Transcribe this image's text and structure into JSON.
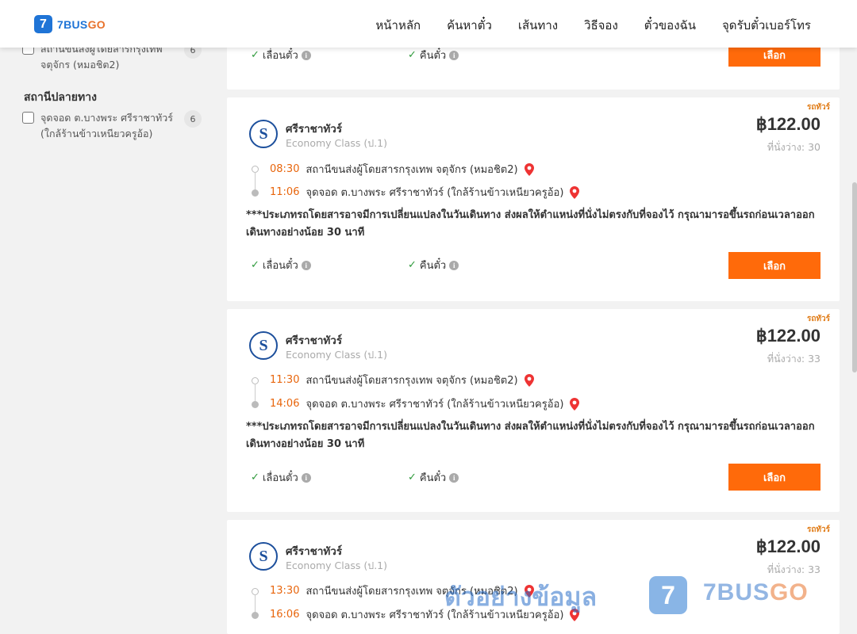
{
  "header": {
    "logo_number": "7",
    "logo_text_main": "BUS",
    "logo_text_go": "GO",
    "nav": [
      "หน้าหลัก",
      "ค้นหาตั๋ว",
      "เส้นทาง",
      "วิธีจอง",
      "ตั๋วของฉัน",
      "จุดรับตั๋วเบอร์โทร"
    ]
  },
  "sidebar": {
    "origin_item": {
      "label": "สถานีขนส่งผู้โดยสารกรุงเทพ จตุจักร (หมอชิต2)",
      "count": "6"
    },
    "destination_heading": "สถานีปลายทาง",
    "destination_item": {
      "label": "จุดจอด ต.บางพระ ศรีราชาทัวร์ (ใกล้ร้านข้าวเหนียวครูอ้อ)",
      "count": "6"
    }
  },
  "top_partial": {
    "feature_reschedule": "เลื่อนตั๋ว",
    "feature_refund": "คืนตั๋ว",
    "select_label": "เลือก"
  },
  "trips": [
    {
      "bus_type": "รถทัวร์",
      "operator": "ศรีราชาทัวร์",
      "class": "Economy Class (ป.1)",
      "price": "฿122.00",
      "seats": "ที่นั่งว่าง: 30",
      "depart_time": "08:30",
      "depart_station": "สถานีขนส่งผู้โดยสารกรุงเทพ จตุจักร (หมอชิต2)",
      "arrive_time": "11:06",
      "arrive_station": "จุดจอด ต.บางพระ ศรีราชาทัวร์ (ใกล้ร้านข้าวเหนียวครูอ้อ)",
      "note": "***ประเภทรถโดยสารอาจมีการเปลี่ยนแปลงในวันเดินทาง ส่งผลให้ตำแหน่งที่นั่งไม่ตรงกับที่จองไว้ กรุณามารอขึ้นรถก่อนเวลาออกเดินทางอย่างน้อย 30 นาที",
      "feature_reschedule": "เลื่อนตั๋ว",
      "feature_refund": "คืนตั๋ว",
      "select_label": "เลือก"
    },
    {
      "bus_type": "รถทัวร์",
      "operator": "ศรีราชาทัวร์",
      "class": "Economy Class (ป.1)",
      "price": "฿122.00",
      "seats": "ที่นั่งว่าง: 33",
      "depart_time": "11:30",
      "depart_station": "สถานีขนส่งผู้โดยสารกรุงเทพ จตุจักร (หมอชิต2)",
      "arrive_time": "14:06",
      "arrive_station": "จุดจอด ต.บางพระ ศรีราชาทัวร์ (ใกล้ร้านข้าวเหนียวครูอ้อ)",
      "note": "***ประเภทรถโดยสารอาจมีการเปลี่ยนแปลงในวันเดินทาง ส่งผลให้ตำแหน่งที่นั่งไม่ตรงกับที่จองไว้ กรุณามารอขึ้นรถก่อนเวลาออกเดินทางอย่างน้อย 30 นาที",
      "feature_reschedule": "เลื่อนตั๋ว",
      "feature_refund": "คืนตั๋ว",
      "select_label": "เลือก"
    },
    {
      "bus_type": "รถทัวร์",
      "operator": "ศรีราชาทัวร์",
      "class": "Economy Class (ป.1)",
      "price": "฿122.00",
      "seats": "ที่นั่งว่าง: 33",
      "depart_time": "13:30",
      "depart_station": "สถานีขนส่งผู้โดยสารกรุงเทพ จตุจักร (หมอชิต2)",
      "arrive_time": "16:06",
      "arrive_station": "จุดจอด ต.บางพระ ศรีราชาทัวร์ (ใกล้ร้านข้าวเหนียวครูอ้อ)"
    }
  ],
  "icons": {
    "operator_logo_letter": "S",
    "check": "✓",
    "info": "i"
  },
  "watermark": {
    "text": "ตัวอย่างข้อมูล",
    "mark": "7",
    "brand_main": "7BUS",
    "brand_go": "GO"
  },
  "colors": {
    "accent": "#ff6a0a",
    "time": "#e8650c",
    "brand_blue": "#1f74d6",
    "check": "#2e9a3b"
  }
}
